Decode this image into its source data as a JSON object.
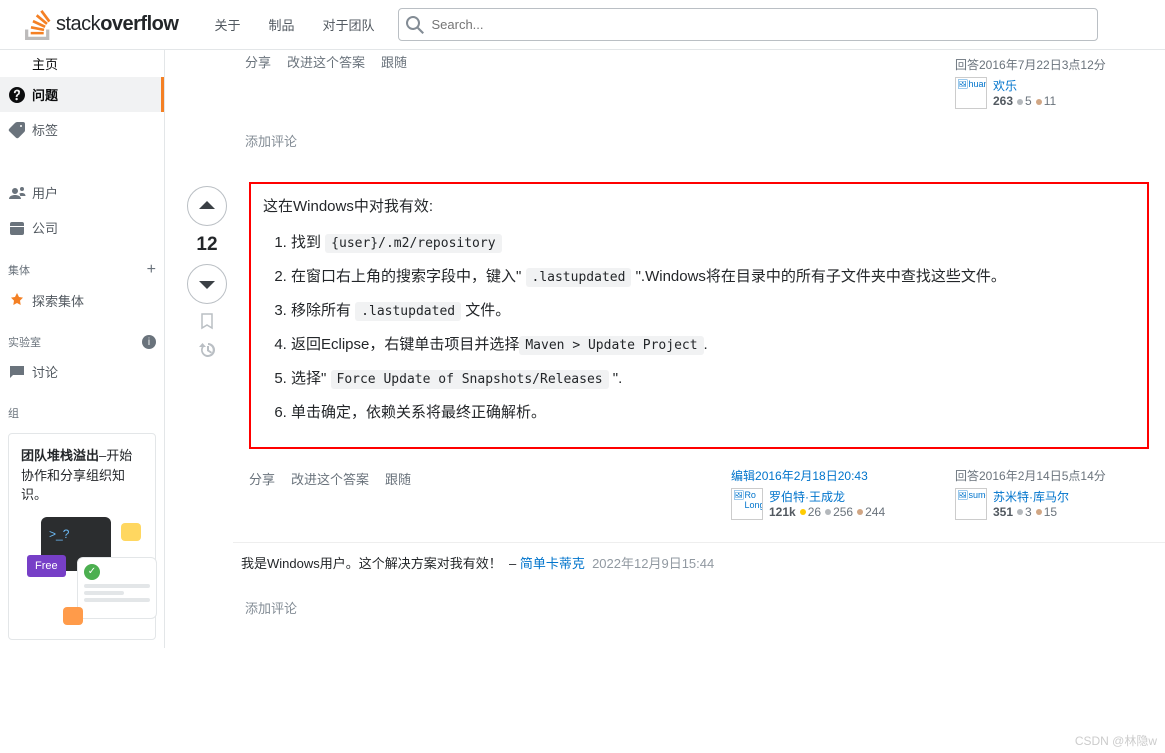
{
  "topbar": {
    "links": [
      "关于",
      "制品",
      "对于团队"
    ],
    "search_placeholder": "Search..."
  },
  "nav": {
    "home": "主页",
    "questions": "问题",
    "tags": "标签",
    "users": "用户",
    "companies": "公司",
    "collectives_header": "集体",
    "explore_collectives": "探索集体",
    "labs_header": "实验室",
    "discussion": "讨论",
    "teams_header": "组",
    "teams_pitch_bold": "团队堆栈溢出",
    "teams_pitch_rest": "–开始协作和分享组织知识。",
    "free_badge": "Free"
  },
  "post_menu": {
    "share": "分享",
    "improve": "改进这个答案",
    "follow": "跟随"
  },
  "answer1": {
    "sig_time": "回答2016年7月22日3点12分",
    "avatar_alt": "huan",
    "user_name": "欢乐",
    "rep": "263",
    "silver": "5",
    "bronze": "11",
    "add_comment": "添加评论"
  },
  "answer2": {
    "score": "12",
    "intro": "这在Windows中对我有效:",
    "steps": {
      "s1a": "找到 ",
      "s1_code": "{user}/.m2/repository",
      "s2a": "在窗口右上角的搜索字段中，键入\" ",
      "s2_code": ".lastupdated",
      "s2b": " \".Windows将在目录中的所有子文件夹中查找这些文件。",
      "s3a": "移除所有 ",
      "s3_code": ".lastupdated",
      "s3b": " 文件。",
      "s4a": "返回Eclipse，右键单击项目并选择",
      "s4_code": "Maven > Update Project",
      "s4b": ".",
      "s5a": "选择\" ",
      "s5_code": "Force Update of Snapshots/Releases",
      "s5b": " \".",
      "s6": "单击确定，依赖关系将最终正确解析。"
    },
    "edit_label": "编辑",
    "edit_time": "2016年2月18日20:43",
    "editor_avatar_alt": "Ro Longs",
    "editor_name": "罗伯特·王成龙",
    "editor_rep": "121k",
    "editor_gold": "26",
    "editor_silver": "256",
    "editor_bronze": "244",
    "sig_time": "回答2016年2月14日5点14分",
    "avatar_alt": "sume",
    "user_name": "苏米特·库马尔",
    "rep": "351",
    "silver": "3",
    "bronze": "15",
    "comment_text": "我是Windows用户。这个解决方案对我有效！",
    "comment_user": "简单卡蒂克",
    "comment_time": "2022年12月9日15:44",
    "add_comment": "添加评论"
  },
  "watermark": "CSDN @林隐w"
}
